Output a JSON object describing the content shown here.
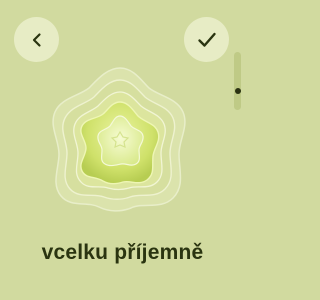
{
  "nav": {
    "back_icon": "chevron-left-icon",
    "done_icon": "checkmark-icon"
  },
  "mood": {
    "label": "vcelku příjemně",
    "level_fraction": 0.75
  },
  "colors": {
    "background": "#d1da9f",
    "button_fill": "#e7ecc5",
    "text": "#2a3410",
    "flower_center": "#cbe06a"
  }
}
